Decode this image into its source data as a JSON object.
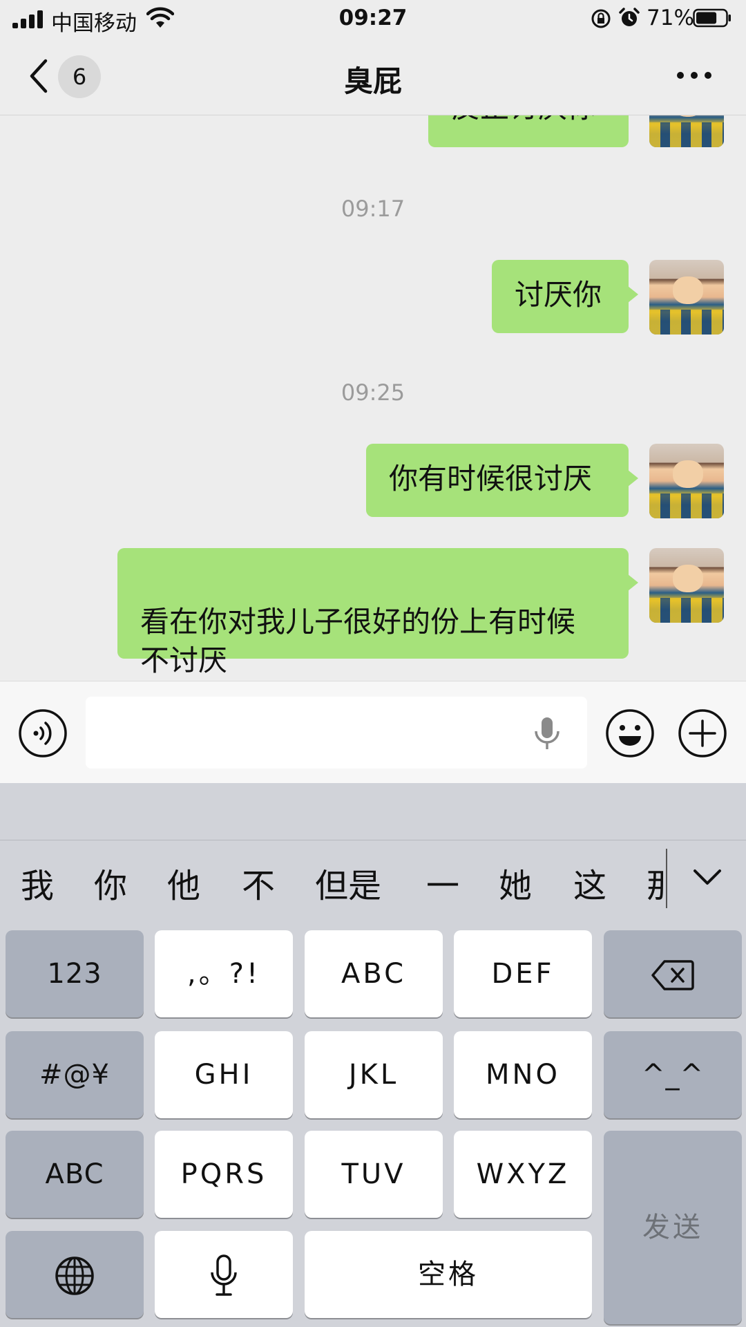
{
  "status_bar": {
    "carrier": "中国移动",
    "time": "09:27",
    "battery_percent": "71%",
    "battery_level": 0.71,
    "icons": [
      "signal-icon",
      "wifi-icon",
      "orientation-lock-icon",
      "alarm-icon",
      "battery-icon"
    ]
  },
  "nav": {
    "back_badge": "6",
    "title": "臭屁",
    "icons": [
      "chevron-left-icon",
      "more-icon"
    ]
  },
  "chat": {
    "partial_message": "反正讨厌你",
    "timestamps": [
      "09:17",
      "09:25"
    ],
    "messages": [
      {
        "text": "讨厌你",
        "sender": "me"
      },
      {
        "text": "你有时候很讨厌",
        "sender": "me"
      },
      {
        "text": "看在你对我儿子很好的份上有时候\n不讨厌",
        "sender": "me"
      }
    ]
  },
  "input_bar": {
    "value": "",
    "icons": [
      "voice-icon",
      "microphone-icon",
      "emoji-icon",
      "plus-icon"
    ]
  },
  "keyboard": {
    "candidates": [
      "我",
      "你",
      "他",
      "不",
      "但是",
      "一",
      "她",
      "这",
      "那"
    ],
    "rows": [
      [
        "123",
        ",。?!",
        "ABC",
        "DEF",
        "backspace"
      ],
      [
        "#@¥",
        "GHI",
        "JKL",
        "MNO",
        "^_^"
      ],
      [
        "ABC",
        "PQRS",
        "TUV",
        "WXYZ",
        "发送"
      ],
      [
        "globe",
        "mic",
        "空格"
      ]
    ],
    "icons": [
      "chevron-down-icon",
      "backspace-icon",
      "globe-icon",
      "microphone-icon"
    ],
    "colors": {
      "bubble": "#a6e27a",
      "keyboard_bg": "#d1d3d9",
      "dark_key": "#aab0bc"
    }
  }
}
